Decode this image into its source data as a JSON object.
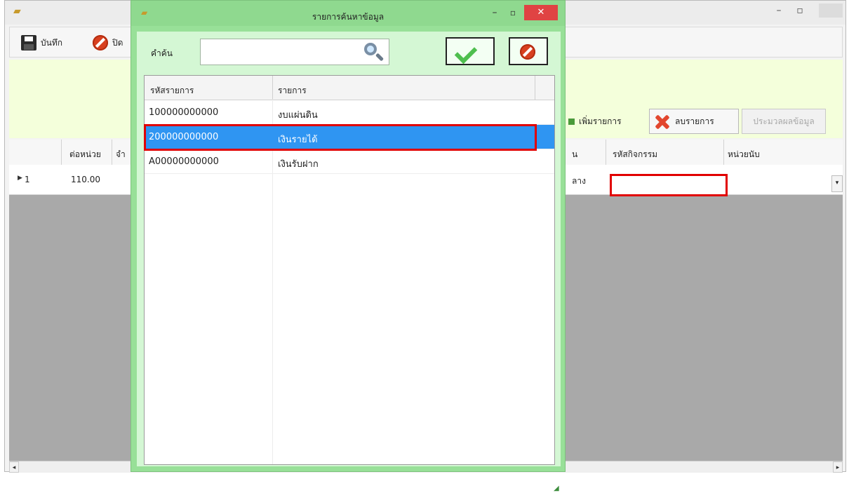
{
  "main_window": {
    "toolbar": {
      "save_label": "บันทึก",
      "close_label": "ปิด"
    },
    "buttons": {
      "add_row": "เพิ่มรายการ",
      "delete_row": "ลบรายการ",
      "process": "ประมวลผลข้อมูล"
    },
    "grid": {
      "columns": [
        "ต่อหน่วย",
        "จำ",
        "น",
        "รหัสกิจกรรม",
        "หน่วยนับ"
      ],
      "row": {
        "index": "1",
        "unit_price": "110.00",
        "partial": "ลาง",
        "activity_code": "",
        "unit": ""
      }
    }
  },
  "search_dialog": {
    "title": "รายการค้นหาข้อมูล",
    "search_label": "คำค้น",
    "search_value": "",
    "columns": [
      "รหัสรายการ",
      "รายการ"
    ],
    "rows": [
      {
        "code": "100000000000",
        "name": "งบแผ่นดิน"
      },
      {
        "code": "200000000000",
        "name": "เงินรายได้"
      },
      {
        "code": "A00000000000",
        "name": "เงินรับฝาก"
      }
    ],
    "selected_row": 1
  },
  "colors": {
    "dialog_bg": "#98e098",
    "selection": "#2f95f2",
    "highlight_box": "#e10000",
    "header_panel": "#f4ffdb"
  },
  "icons": [
    "app-icon",
    "floppy-disk-icon",
    "stop-icon",
    "add-icon",
    "red-x-icon",
    "search-icon",
    "check-icon",
    "close-icon",
    "minimize-icon",
    "maximize-icon",
    "row-pointer-icon",
    "dropdown-arrow-icon",
    "resize-grip-icon"
  ]
}
